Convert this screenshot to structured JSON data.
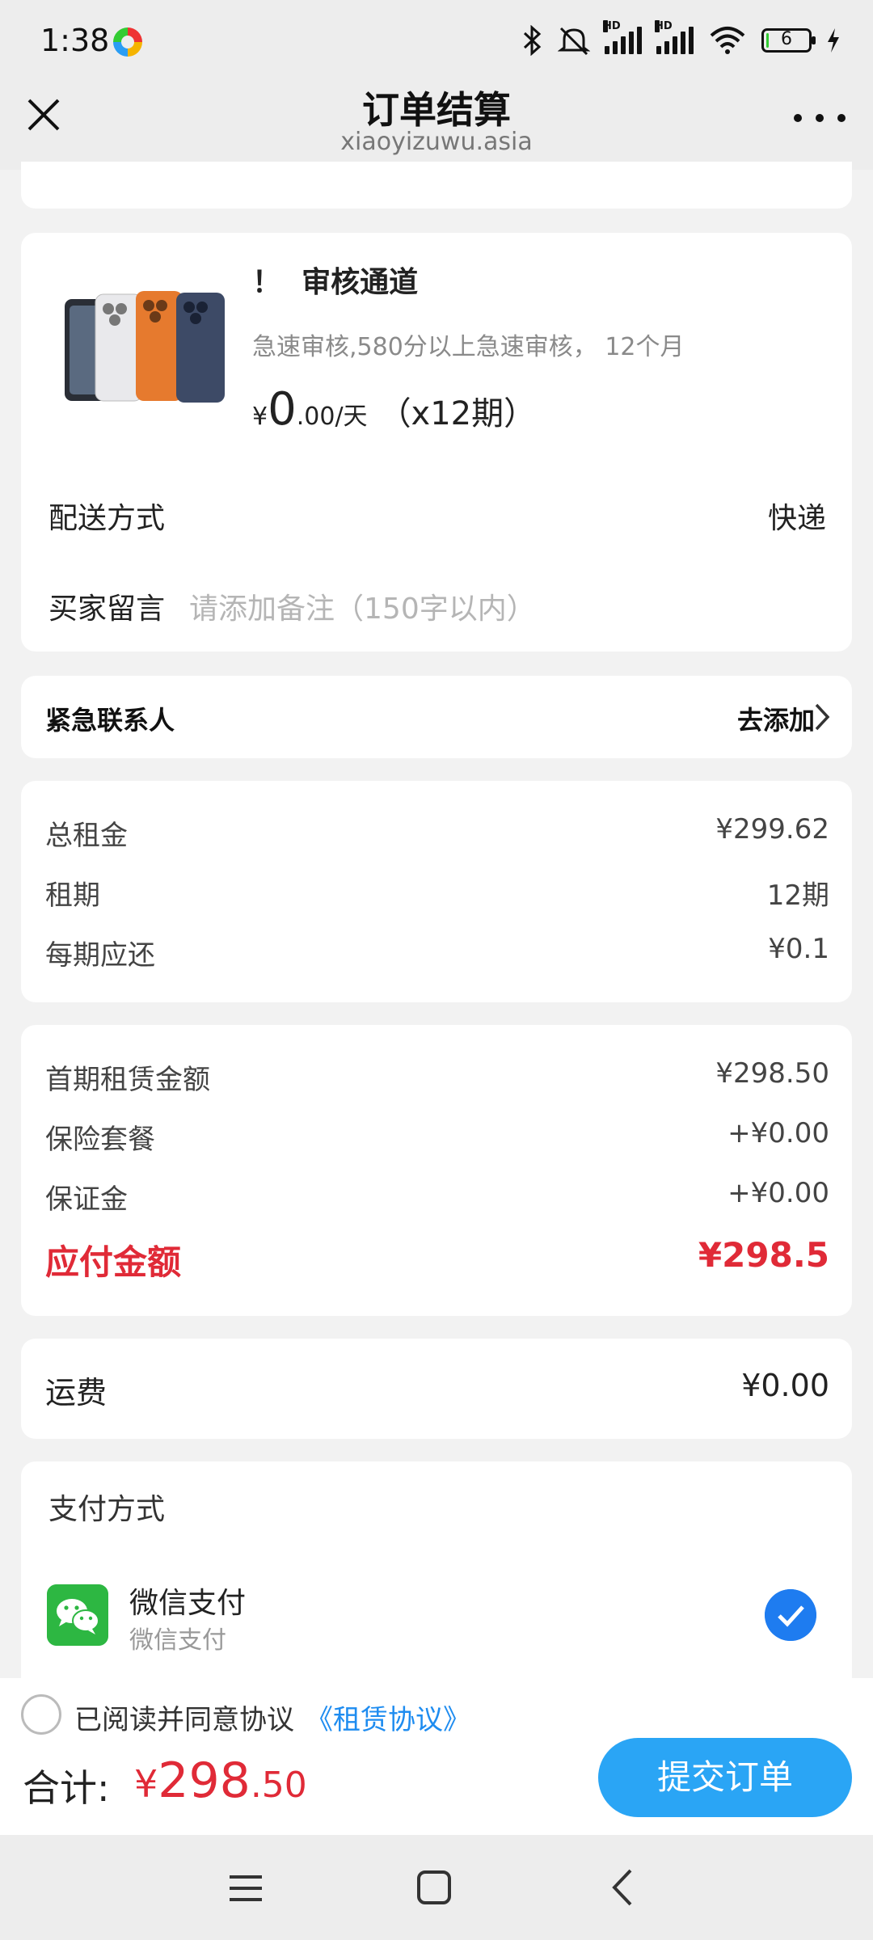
{
  "status_bar": {
    "time": "1:38",
    "battery": "6"
  },
  "header": {
    "title": "订单结算",
    "subtitle": "xiaoyizuwu.asia"
  },
  "product": {
    "name": "！  审核通道",
    "desc": "急速审核,580分以上急速审核， 12个月",
    "price_currency": "¥",
    "price_int": "0",
    "price_dec": ".00",
    "price_unit": "/天",
    "price_period": "（x12期）"
  },
  "delivery": {
    "label": "配送方式",
    "value": "快递"
  },
  "remark": {
    "label": "买家留言",
    "placeholder": "请添加备注（150字以内）"
  },
  "emergency_contact": {
    "label": "紧急联系人",
    "action": "去添加"
  },
  "rent_summary": [
    {
      "label": "总租金",
      "value": "¥299.62"
    },
    {
      "label": "租期",
      "value": "12期"
    },
    {
      "label": "每期应还",
      "value": "¥0.1"
    }
  ],
  "fees": [
    {
      "label": "首期租赁金额",
      "value": "¥298.50"
    },
    {
      "label": "保险套餐",
      "value": "+¥0.00"
    },
    {
      "label": "保证金",
      "value": "+¥0.00"
    }
  ],
  "amount_due": {
    "label": "应付金额",
    "value": "¥298.5"
  },
  "shipping": {
    "label": "运费",
    "value": "¥0.00"
  },
  "payment": {
    "title": "支付方式",
    "method_name": "微信支付",
    "method_sub": "微信支付"
  },
  "agreement": {
    "text": "已阅读并同意协议",
    "link": "《租赁协议》"
  },
  "total": {
    "label": "合计:",
    "currency": "¥",
    "int": "298",
    "dec": ".50"
  },
  "submit_label": "提交订单",
  "colors": {
    "accent_red": "#e02a37",
    "accent_blue": "#2aa5f5",
    "wechat_green": "#2db742"
  }
}
